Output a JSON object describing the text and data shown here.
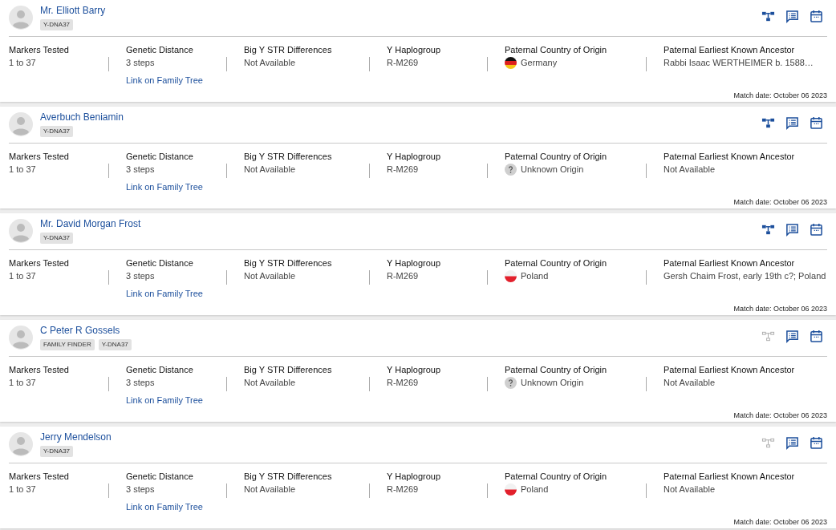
{
  "matches": [
    {
      "name": "Mr. Elliott Barry",
      "tags": [
        "Y-DNA37"
      ],
      "tree_linked": true,
      "fields": [
        {
          "label": "Markers Tested",
          "value": "1 to 37"
        },
        {
          "label": "Genetic Distance",
          "value": "3 steps",
          "link": "Link on Family Tree"
        },
        {
          "label": "Big Y STR Differences",
          "value": "Not Available"
        },
        {
          "label": "Y Haplogroup",
          "value": "R-M269"
        },
        {
          "label": "Paternal Country of Origin",
          "value": "Germany",
          "kind": "germany"
        },
        {
          "label": "Paternal Earliest Known Ancestor",
          "value": "Rabbi Isaac WERTHEIMER b. 1588…"
        }
      ],
      "match_date": "Match date: October 06 2023"
    },
    {
      "name": "Averbuch Beniamin",
      "tags": [
        "Y-DNA37"
      ],
      "tree_linked": true,
      "fields": [
        {
          "label": "Markers Tested",
          "value": "1 to 37"
        },
        {
          "label": "Genetic Distance",
          "value": "3 steps",
          "link": "Link on Family Tree"
        },
        {
          "label": "Big Y STR Differences",
          "value": "Not Available"
        },
        {
          "label": "Y Haplogroup",
          "value": "R-M269"
        },
        {
          "label": "Paternal Country of Origin",
          "value": "Unknown Origin",
          "kind": "unknown"
        },
        {
          "label": "Paternal Earliest Known Ancestor",
          "value": "Not Available"
        }
      ],
      "match_date": "Match date: October 06 2023"
    },
    {
      "name": "Mr. David Morgan Frost",
      "tags": [
        "Y-DNA37"
      ],
      "tree_linked": true,
      "fields": [
        {
          "label": "Markers Tested",
          "value": "1 to 37"
        },
        {
          "label": "Genetic Distance",
          "value": "3 steps",
          "link": "Link on Family Tree"
        },
        {
          "label": "Big Y STR Differences",
          "value": "Not Available"
        },
        {
          "label": "Y Haplogroup",
          "value": "R-M269"
        },
        {
          "label": "Paternal Country of Origin",
          "value": "Poland",
          "kind": "poland"
        },
        {
          "label": "Paternal Earliest Known Ancestor",
          "value": "Gersh Chaim Frost, early 19th c?; Poland"
        }
      ],
      "match_date": "Match date: October 06 2023"
    },
    {
      "name": "C Peter R Gossels",
      "tags": [
        "FAMILY FINDER",
        "Y-DNA37"
      ],
      "tree_linked": false,
      "fields": [
        {
          "label": "Markers Tested",
          "value": "1 to 37"
        },
        {
          "label": "Genetic Distance",
          "value": "3 steps",
          "link": "Link on Family Tree"
        },
        {
          "label": "Big Y STR Differences",
          "value": "Not Available"
        },
        {
          "label": "Y Haplogroup",
          "value": "R-M269"
        },
        {
          "label": "Paternal Country of Origin",
          "value": "Unknown Origin",
          "kind": "unknown"
        },
        {
          "label": "Paternal Earliest Known Ancestor",
          "value": "Not Available"
        }
      ],
      "match_date": "Match date: October 06 2023"
    },
    {
      "name": "Jerry Mendelson",
      "tags": [
        "Y-DNA37"
      ],
      "tree_linked": false,
      "fields": [
        {
          "label": "Markers Tested",
          "value": "1 to 37"
        },
        {
          "label": "Genetic Distance",
          "value": "3 steps",
          "link": "Link on Family Tree"
        },
        {
          "label": "Big Y STR Differences",
          "value": "Not Available"
        },
        {
          "label": "Y Haplogroup",
          "value": "R-M269"
        },
        {
          "label": "Paternal Country of Origin",
          "value": "Poland",
          "kind": "poland"
        },
        {
          "label": "Paternal Earliest Known Ancestor",
          "value": "Not Available"
        }
      ],
      "match_date": "Match date: October 06 2023"
    }
  ]
}
